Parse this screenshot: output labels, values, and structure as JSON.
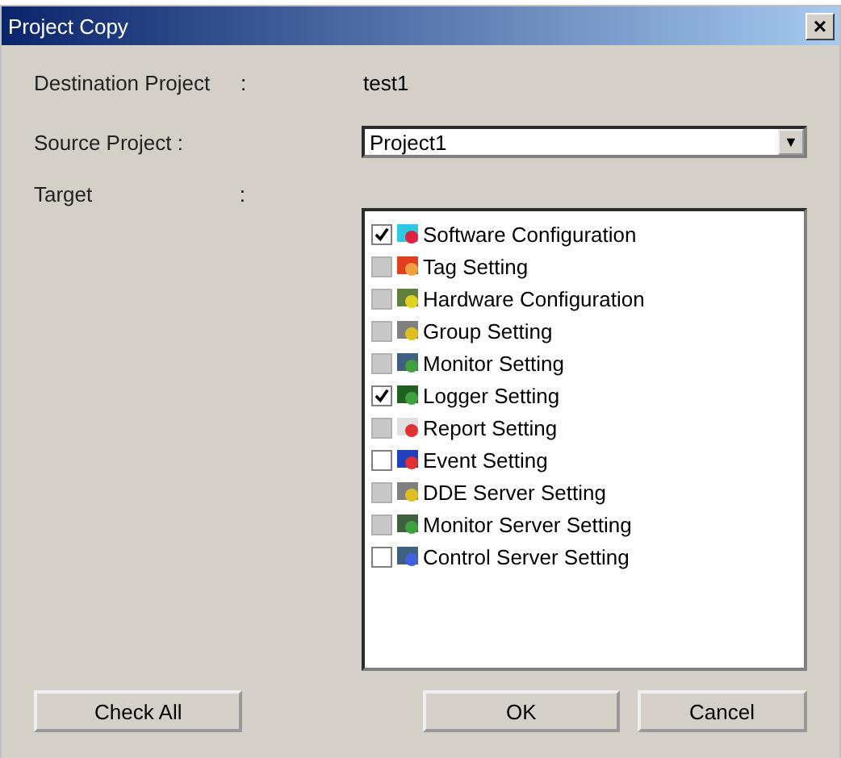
{
  "window": {
    "title": "Project Copy",
    "close": "×"
  },
  "destination": {
    "label": "Destination Project",
    "colon": ":",
    "value": "test1"
  },
  "source": {
    "label": "Source Project :",
    "value": "Project1",
    "arrow": "▼"
  },
  "target": {
    "label": "Target",
    "colon": ":"
  },
  "items": [
    {
      "label": "Software Configuration",
      "checked": true,
      "disabled": false
    },
    {
      "label": "Tag Setting",
      "checked": false,
      "disabled": true
    },
    {
      "label": "Hardware Configuration",
      "checked": false,
      "disabled": true
    },
    {
      "label": "Group Setting",
      "checked": false,
      "disabled": true
    },
    {
      "label": "Monitor Setting",
      "checked": false,
      "disabled": true
    },
    {
      "label": "Logger Setting",
      "checked": true,
      "disabled": false
    },
    {
      "label": "Report Setting",
      "checked": false,
      "disabled": true
    },
    {
      "label": "Event Setting",
      "checked": false,
      "disabled": false
    },
    {
      "label": "DDE Server Setting",
      "checked": false,
      "disabled": true
    },
    {
      "label": "Monitor Server Setting",
      "checked": false,
      "disabled": true
    },
    {
      "label": "Control Server Setting",
      "checked": false,
      "disabled": false
    }
  ],
  "buttons": {
    "check_all": "Check All",
    "ok": "OK",
    "cancel": "Cancel"
  }
}
